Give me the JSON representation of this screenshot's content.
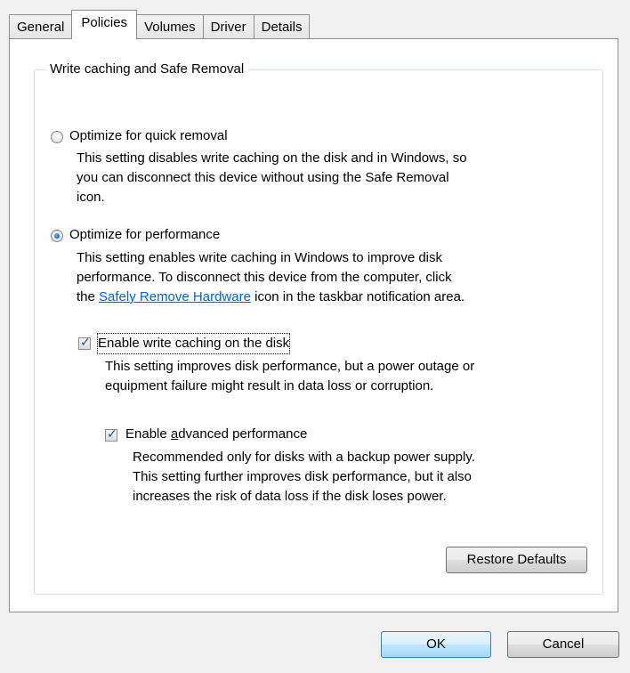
{
  "tabs": [
    {
      "label": "General"
    },
    {
      "label": "Policies",
      "active": true
    },
    {
      "label": "Volumes"
    },
    {
      "label": "Driver"
    },
    {
      "label": "Details"
    }
  ],
  "group": {
    "title": "Write caching and Safe Removal"
  },
  "quick_removal": {
    "label": "Optimize for quick removal",
    "selected": false,
    "desc_lines": [
      "This setting disables write caching on the disk and in Windows, so",
      "you can disconnect this device without using the Safe Removal",
      "icon."
    ]
  },
  "performance": {
    "label": "Optimize for performance",
    "selected": true,
    "desc_line1": "This setting enables write caching in Windows to improve disk",
    "desc_line2": "performance. To disconnect this device from the computer, click",
    "desc_line3_pre": "the ",
    "desc_line3_link": "Safely Remove Hardware",
    "desc_line3_post": " icon in the taskbar notification area."
  },
  "write_caching": {
    "label": "Enable write caching on the disk",
    "checked": true,
    "desc_lines": [
      "This setting improves disk performance, but a power outage or",
      "equipment failure might result in data loss or corruption."
    ]
  },
  "advanced_performance": {
    "label_pre": "Enable ",
    "label_accel": "a",
    "label_post": "dvanced performance",
    "checked": true,
    "desc_lines": [
      "Recommended only for disks with a backup power supply.",
      "This setting further improves disk performance, but it also",
      "increases the risk of data loss if the disk loses power."
    ]
  },
  "buttons": {
    "restore_defaults": "Restore Defaults",
    "ok": "OK",
    "cancel": "Cancel"
  },
  "colors": {
    "link": "#0066cc",
    "default_button_border": "#3c7fb1",
    "panel_background": "#ffffff",
    "dialog_background": "#f0f0f0"
  }
}
